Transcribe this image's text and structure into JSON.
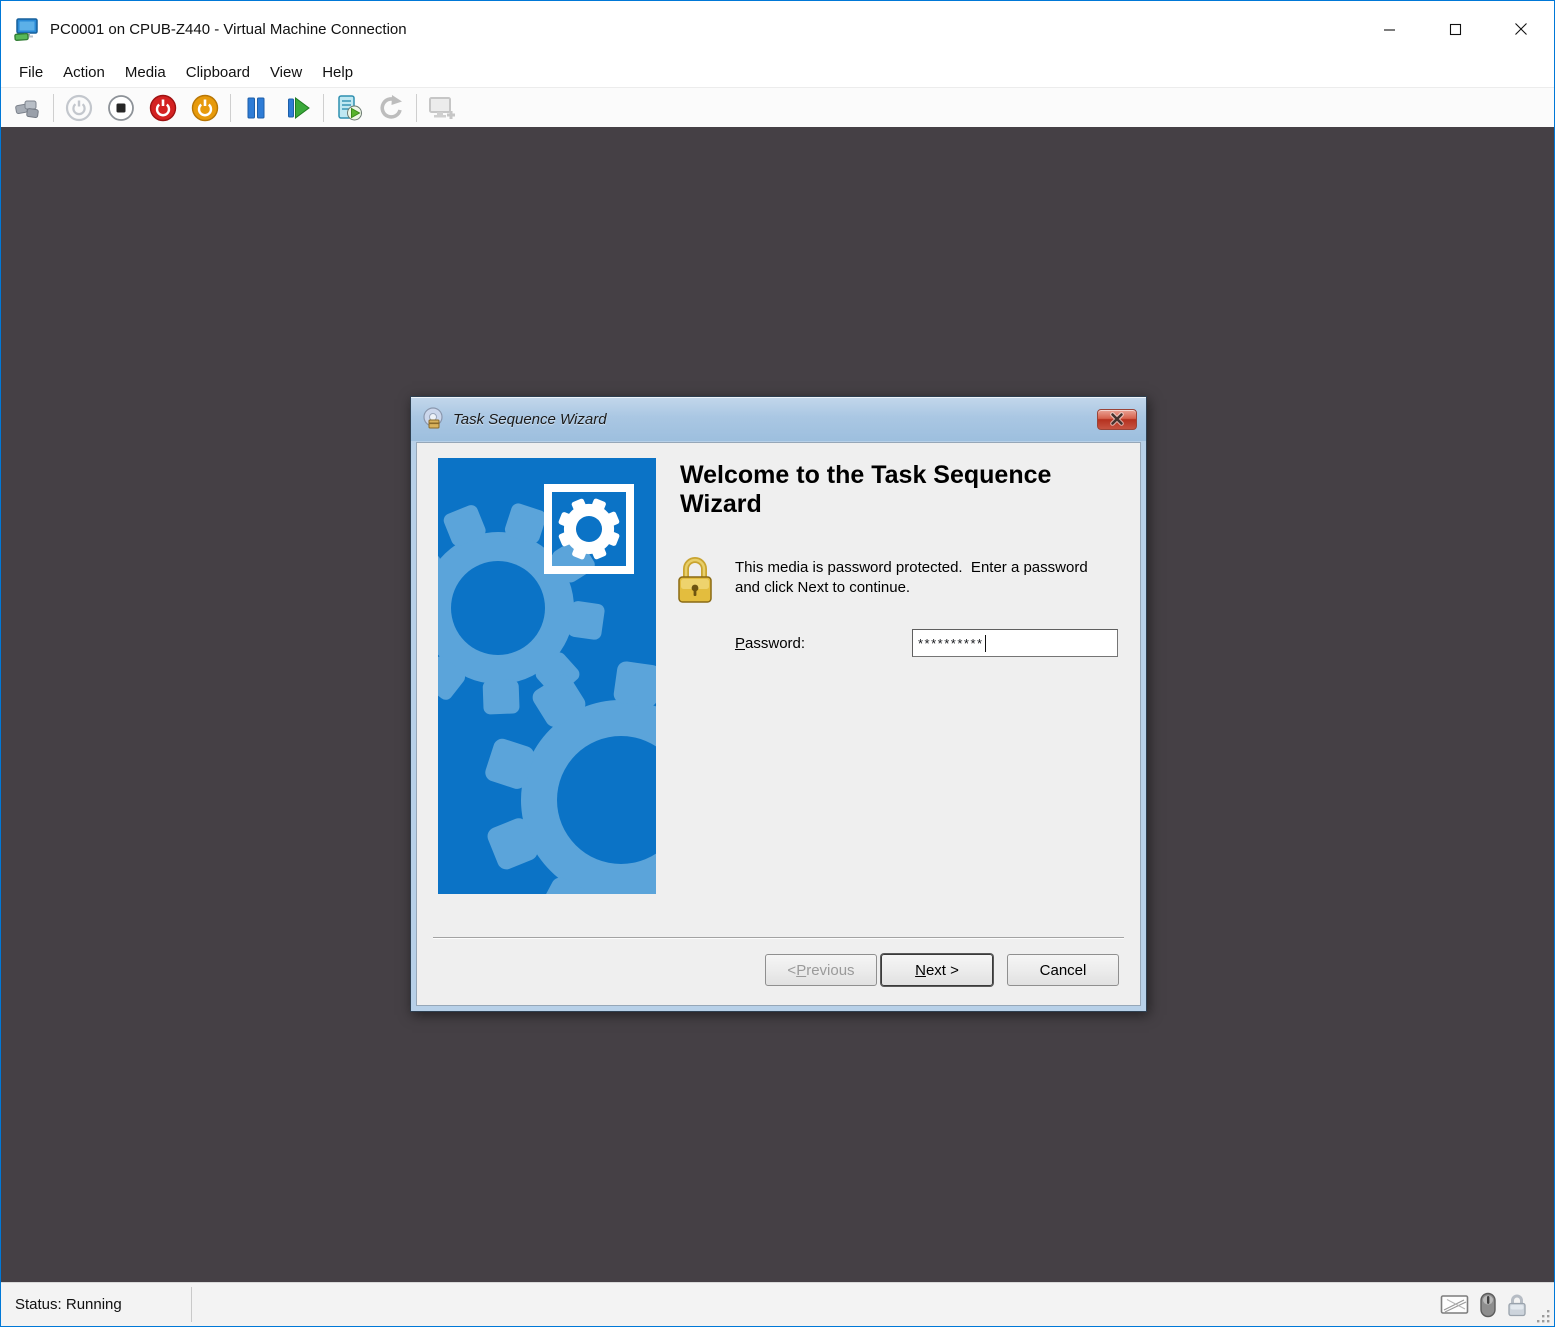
{
  "window": {
    "title": "PC0001 on CPUB-Z440 - Virtual Machine Connection",
    "menu": {
      "items": [
        "File",
        "Action",
        "Media",
        "Clipboard",
        "View",
        "Help"
      ]
    },
    "toolbar": {
      "icons": [
        "ctrl-alt-del",
        "start",
        "turn-off",
        "shut-down",
        "save",
        "pause",
        "reset",
        "checkpoint",
        "revert",
        "enhanced-session"
      ]
    },
    "statusbar": {
      "status": "Status: Running",
      "icons": [
        "keyboard-indicator",
        "mouse-indicator",
        "lock-indicator"
      ]
    }
  },
  "dialog": {
    "title": "Task Sequence Wizard",
    "heading": "Welcome to the Task Sequence Wizard",
    "body_text": "This media is password protected.  Enter a password\nand click Next to continue.",
    "password": {
      "label_key": "P",
      "label_rest": "assword:",
      "value": "**********"
    },
    "buttons": {
      "previous_prefix": "< ",
      "previous_key": "P",
      "previous_rest": "revious",
      "next_key": "N",
      "next_rest": "ext >",
      "cancel": "Cancel"
    }
  },
  "colors": {
    "accent": "#0078d7",
    "vm_background": "#454045",
    "panel_blue": "#0b73c6",
    "gear_blue": "#5ba4da",
    "dialog_frame": "#b7d0e8",
    "close_button_red": "#c14a36",
    "titlebar_gradient_top": "#c3d7eb",
    "titlebar_gradient_bottom": "#9dbfde"
  }
}
